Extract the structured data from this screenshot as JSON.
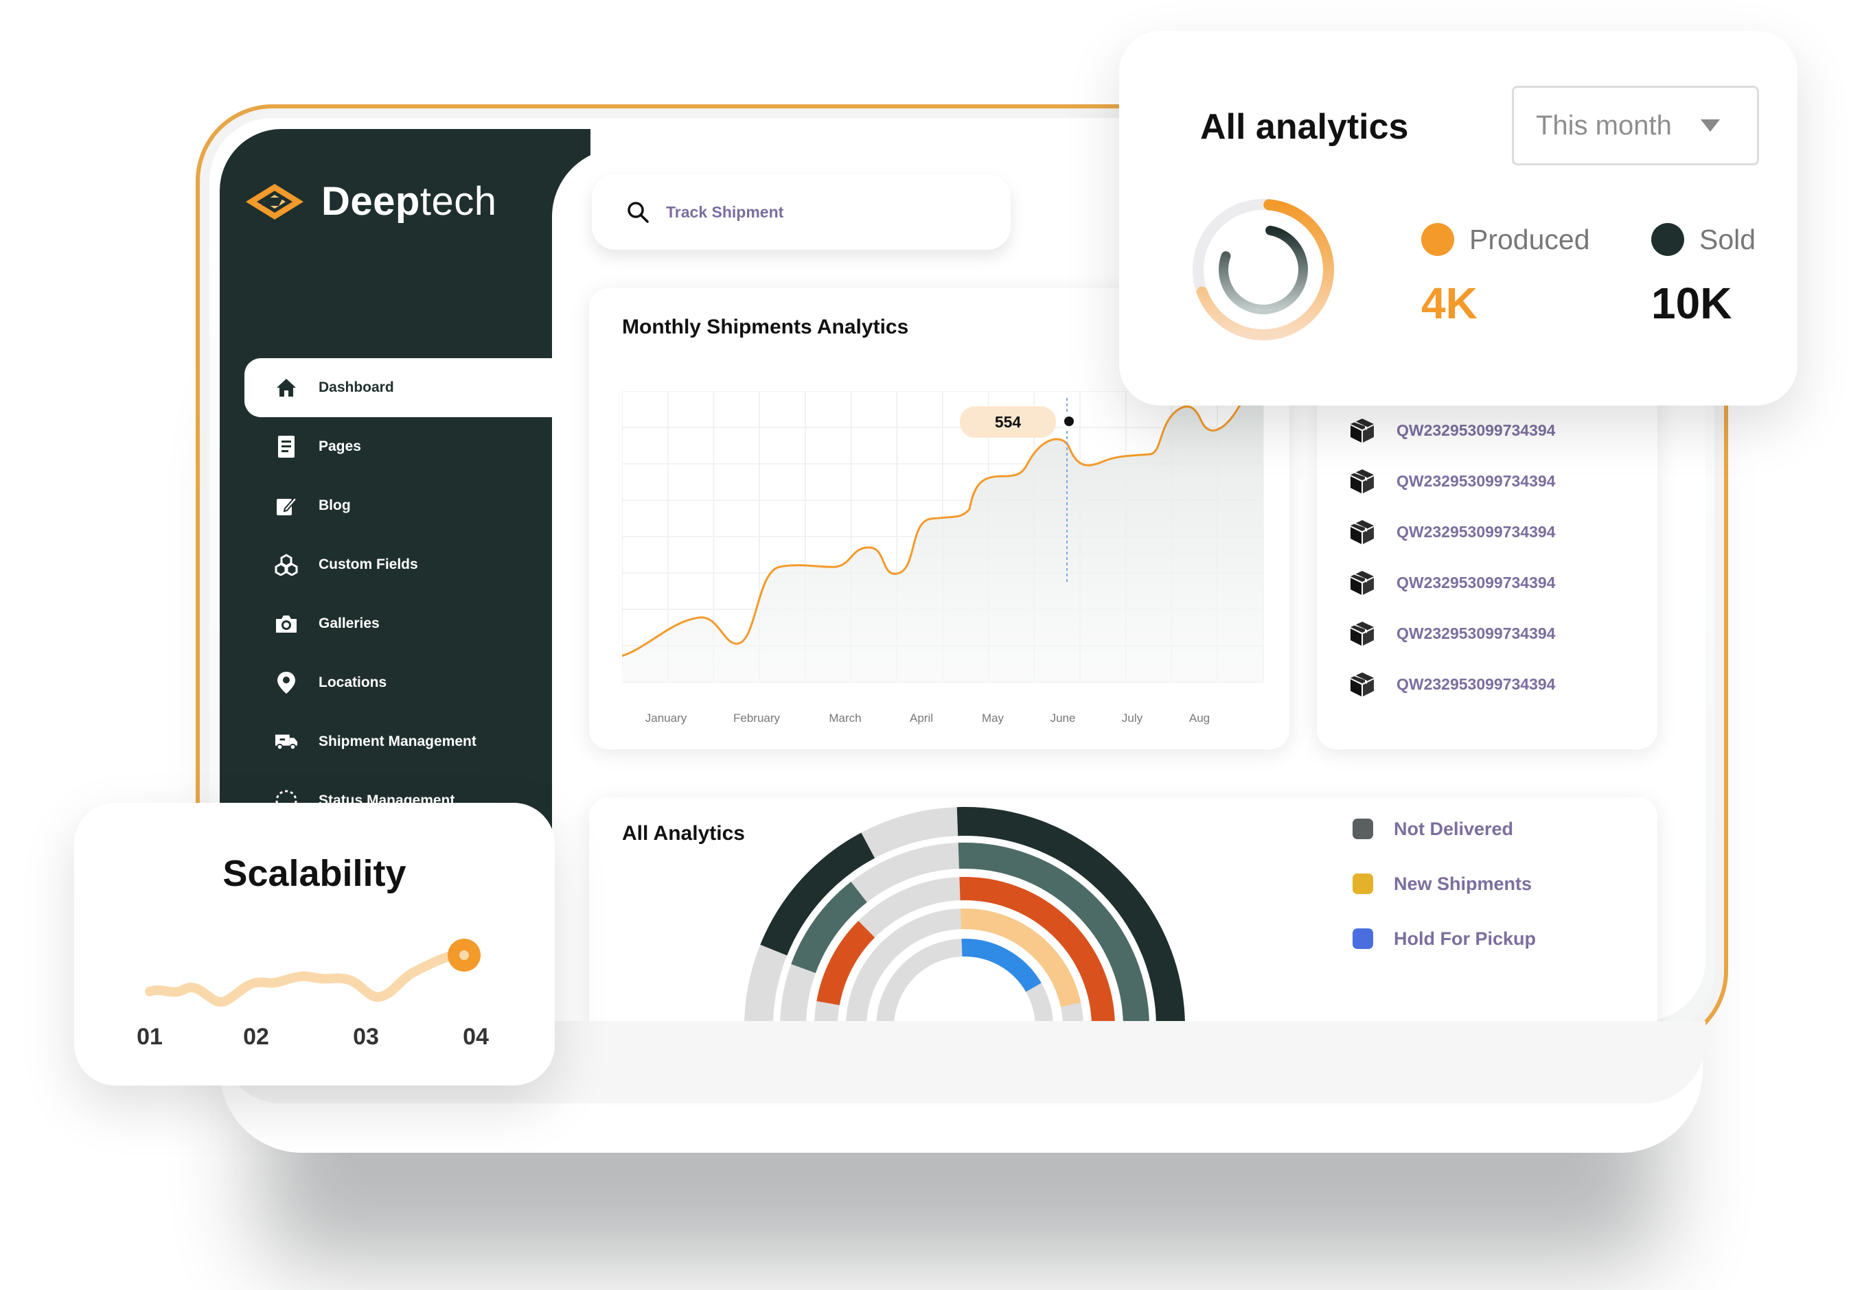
{
  "brand": {
    "name_bold": "Deep",
    "name_light": "tech"
  },
  "sidebar": {
    "items": [
      {
        "label": "Dashboard",
        "icon": "home-icon",
        "active": true
      },
      {
        "label": "Pages",
        "icon": "page-icon"
      },
      {
        "label": "Blog",
        "icon": "edit-icon"
      },
      {
        "label": "Custom Fields",
        "icon": "cubes-icon"
      },
      {
        "label": "Galleries",
        "icon": "camera-icon"
      },
      {
        "label": "Locations",
        "icon": "location-pin-icon"
      },
      {
        "label": "Shipment Management",
        "icon": "truck-icon"
      },
      {
        "label": "Status Management",
        "icon": "status-icon"
      }
    ]
  },
  "search": {
    "placeholder": "Track Shipment"
  },
  "monthly": {
    "title": "Monthly Shipments Analytics",
    "tooltip_value": "554"
  },
  "chart_data": [
    {
      "type": "line",
      "title": "Monthly Shipments Analytics",
      "categories": [
        "January",
        "February",
        "March",
        "April",
        "May",
        "June",
        "July",
        "Aug"
      ],
      "highlight": {
        "category": "June",
        "value": 554
      },
      "grid": true
    },
    {
      "type": "line",
      "title": "Scalability",
      "categories": [
        "01",
        "02",
        "03",
        "04"
      ],
      "grid": false
    },
    {
      "type": "pie",
      "title": "All Analytics",
      "legend": [
        "Not Delivered",
        "New Shipments",
        "Hold For Pickup"
      ],
      "legend_position": "right"
    }
  ],
  "tracking": {
    "items": [
      "QW232953099734394",
      "QW232953099734394",
      "QW232953099734394",
      "QW232953099734394",
      "QW232953099734394",
      "QW232953099734394"
    ]
  },
  "all_analytics": {
    "title": "All Analytics",
    "legend": [
      {
        "label": "Not Delivered",
        "color": "#5a5f60"
      },
      {
        "label": "New Shipments",
        "color": "#e3b22a"
      },
      {
        "label": "Hold For Pickup",
        "color": "#4a6ee0"
      }
    ]
  },
  "analytics_card": {
    "title": "All analytics",
    "dropdown": "This month",
    "produced": {
      "label": "Produced",
      "value": "4K",
      "color": "#f39a2b"
    },
    "sold": {
      "label": "Sold",
      "value": "10K",
      "color": "#1f2f2d"
    }
  },
  "scalability": {
    "title": "Scalability",
    "ticks": [
      "01",
      "02",
      "03",
      "04"
    ]
  },
  "colors": {
    "sidebar": "#1f2f2d",
    "accent": "#f39a2b",
    "frame": "#e7a546",
    "link": "#7b6e9e"
  }
}
